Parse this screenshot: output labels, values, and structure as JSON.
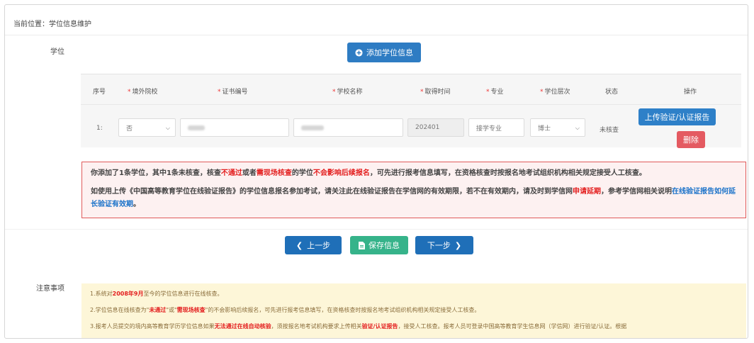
{
  "breadcrumb": "当前位置：学位信息维护",
  "section_label": "学位",
  "add_button_label": "添加学位信息",
  "table": {
    "headers": [
      {
        "label": "序号",
        "required": false
      },
      {
        "label": "境外院校",
        "required": true
      },
      {
        "label": "证书编号",
        "required": true
      },
      {
        "label": "学校名称",
        "required": true
      },
      {
        "label": "取得时间",
        "required": true
      },
      {
        "label": "专业",
        "required": true
      },
      {
        "label": "学位层次",
        "required": true
      },
      {
        "label": "状态",
        "required": false
      },
      {
        "label": "操作",
        "required": false
      }
    ],
    "required_mark": "*",
    "row": {
      "index": "1:",
      "overseas": "否",
      "cert_no": "",
      "school": "",
      "date": "202401",
      "major": "接学专业",
      "level": "博士",
      "status": "未核查",
      "upload_label": "上传验证/认证报告",
      "delete_label": "删除"
    }
  },
  "alert": {
    "line1": {
      "a": "你添加了1条学位，其中1条未核查，核查",
      "b": "不通过",
      "c": "或者",
      "d": "需现场核查",
      "e": "的学位",
      "f": "不会影响后续报名",
      "g": "，可先进行报考信息填写，在资格核查时按报名地考试组织机构相关规定接受人工核查。"
    },
    "line2": {
      "a": "如使用上传《中国高等教育学位在线验证报告》的学位信息报名参加考试，请关注此在线验证报告在学信网的有效期限，若不在有效期内，请及时到学信网",
      "b": "申请延期",
      "c": "，参考学信网相关说明",
      "d": "在线验证报告如何延长验证有效期",
      "e": "。"
    }
  },
  "nav": {
    "prev_label": "上一步",
    "save_label": "保存信息",
    "next_label": "下一步"
  },
  "notice": {
    "label": "注意事项",
    "item1": {
      "a": "1.系统对",
      "b": "2008年9月",
      "c": "至今的学位信息进行在线核查。"
    },
    "item2": {
      "a": "2.学位信息在线核查为\"",
      "b": "未通过",
      "c": "\"或\"",
      "d": "需现场核查",
      "e": "\"的不会影响后续报名，可先进行报考信息填写，在资格核查时按报名地考试组织机构相关规定接受人工核查。"
    },
    "item3": {
      "a": "3.报考人员提交的境内高等教育学历学位信息如果",
      "b": "无法通过在线自动核验",
      "c": "，须按报名地考试机构要求上传相关",
      "d": "验证/认证报告",
      "e": "，接受人工核查。报考人员可登录中国高等教育学生信息网（学信网）进行验证/认证。根据"
    }
  },
  "colors": {
    "primary": "#1f6fb8",
    "success": "#36b38a",
    "danger": "#e45a61",
    "alert_border": "#e05a5a",
    "notice_bg": "#fdf6d8"
  }
}
